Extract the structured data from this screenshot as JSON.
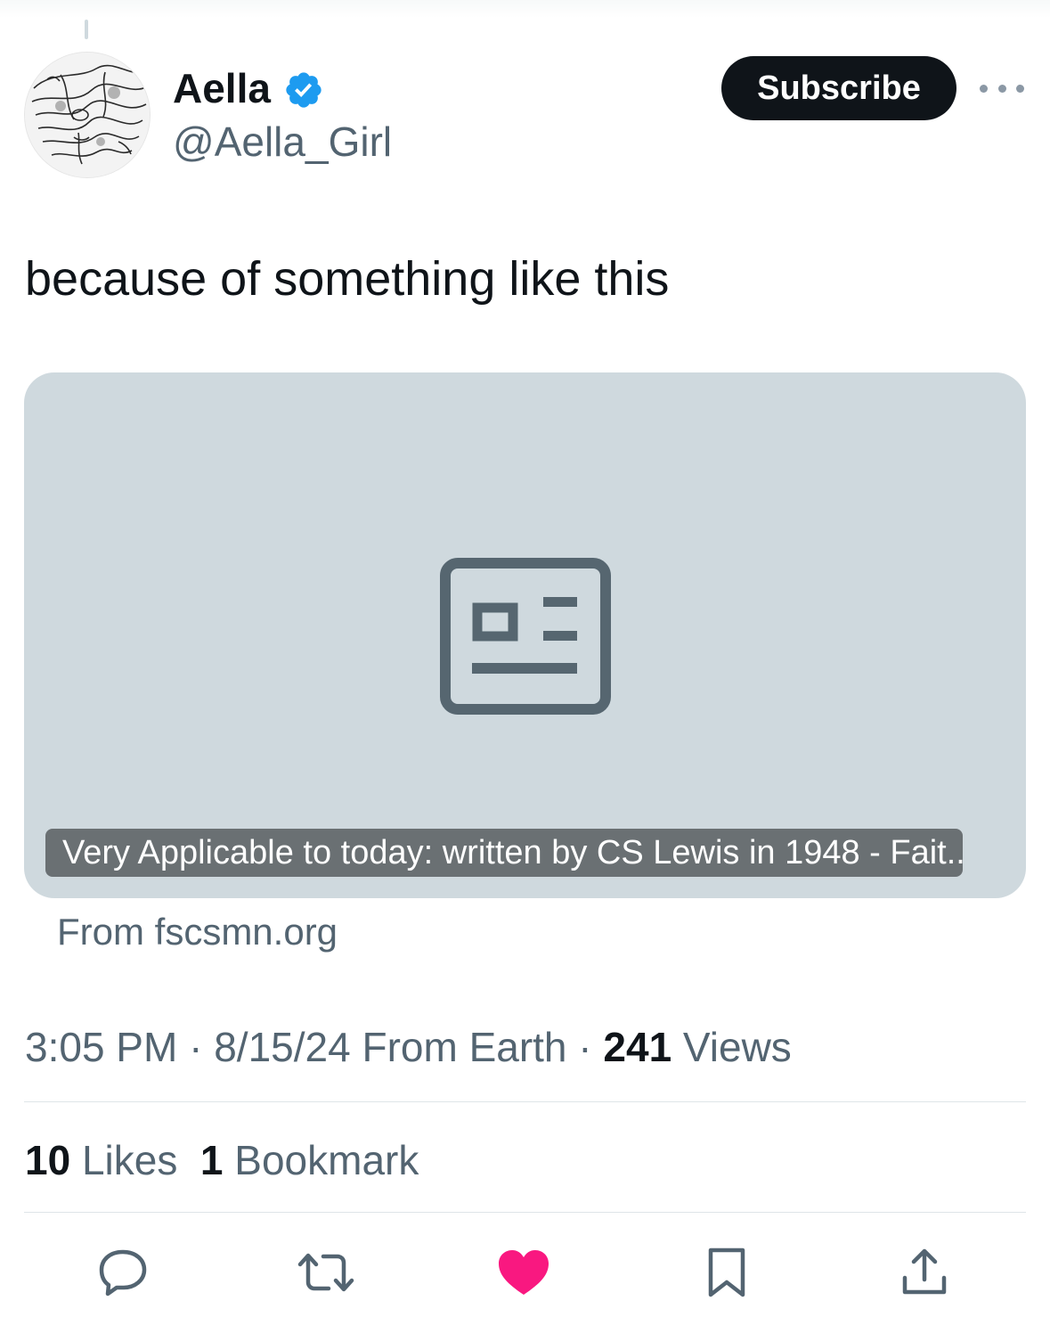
{
  "author": {
    "display_name": "Aella",
    "handle": "@Aella_Girl",
    "verified_icon": "verified-badge-icon",
    "verified_color": "#1d9bf0"
  },
  "header": {
    "subscribe_label": "Subscribe",
    "more_icon": "more-dots-icon"
  },
  "tweet": {
    "text": "because of something like this"
  },
  "link_card": {
    "placeholder_icon": "article-icon",
    "title": "Very Applicable to today: written by CS Lewis in 1948 - Fait...",
    "source": "From fscsmn.org",
    "background": "#cfd9de"
  },
  "meta": {
    "time": "3:05 PM",
    "sep1": " · ",
    "date": "8/15/24",
    "location": " From Earth",
    "sep2": " · ",
    "views_count": "241",
    "views_label": " Views"
  },
  "stats": {
    "likes_count": "10",
    "likes_label": " Likes",
    "bookmarks_count": "1",
    "bookmarks_label": " Bookmark"
  },
  "actions": {
    "reply_icon": "reply-icon",
    "repost_icon": "repost-icon",
    "like_icon": "like-heart-icon",
    "like_color": "#f91880",
    "bookmark_icon": "bookmark-icon",
    "share_icon": "share-icon"
  }
}
